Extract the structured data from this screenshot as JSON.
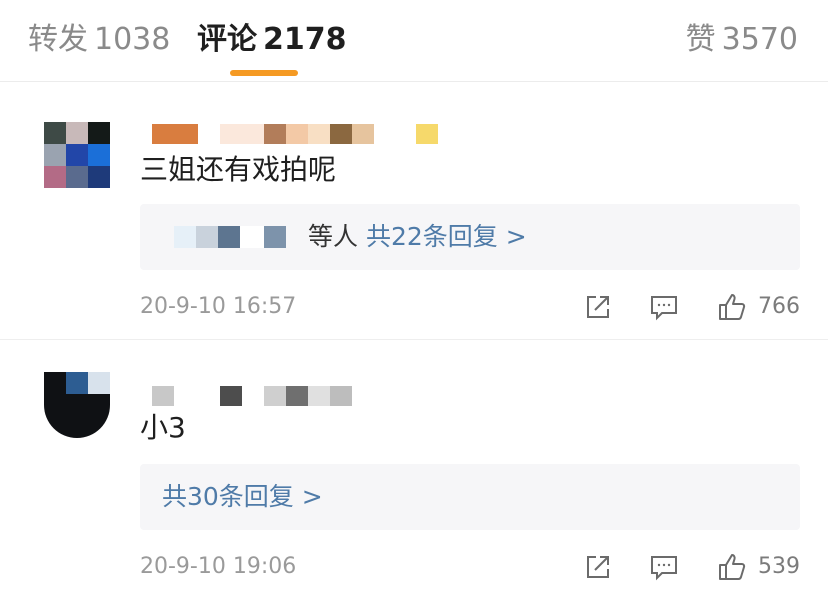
{
  "tabs": {
    "repost": {
      "label": "转发",
      "count": "1038"
    },
    "comment": {
      "label": "评论",
      "count": "2178"
    },
    "like": {
      "label": "赞",
      "count": "3570"
    }
  },
  "comments": [
    {
      "text": "三姐还有戏拍呢",
      "reply_prefix": "等人",
      "reply_link": "共22条回复 >",
      "time": "20-9-10 16:57",
      "likes": "766"
    },
    {
      "text": "小3",
      "reply_link": "共30条回复 >",
      "time": "20-9-10 19:06",
      "likes": "539"
    }
  ],
  "icons": {
    "share": "share-icon",
    "comment": "comment-icon",
    "like": "thumbs-up-icon"
  },
  "colors": {
    "accent_underline": "#f59a23",
    "link": "#4f7ba8"
  }
}
